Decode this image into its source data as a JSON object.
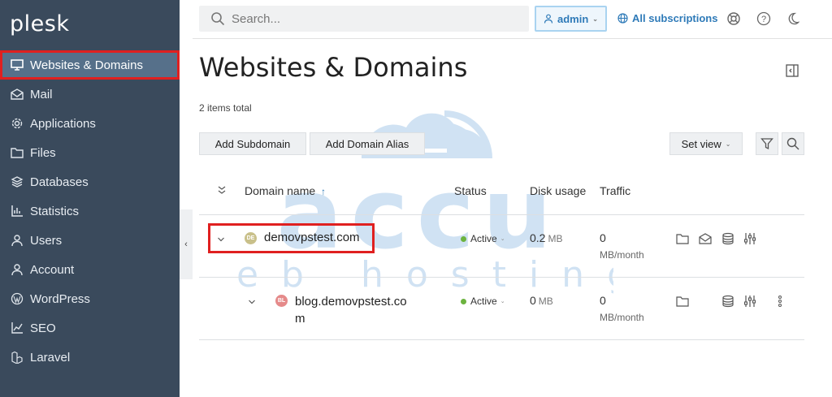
{
  "app": {
    "logo": "plesk"
  },
  "sidebar": {
    "items": [
      {
        "label": "Websites & Domains",
        "icon": "monitor-icon"
      },
      {
        "label": "Mail",
        "icon": "mail-icon"
      },
      {
        "label": "Applications",
        "icon": "gear-icon"
      },
      {
        "label": "Files",
        "icon": "folder-icon"
      },
      {
        "label": "Databases",
        "icon": "database-icon"
      },
      {
        "label": "Statistics",
        "icon": "bar-chart-icon"
      },
      {
        "label": "Users",
        "icon": "user-icon"
      },
      {
        "label": "Account",
        "icon": "account-icon"
      },
      {
        "label": "WordPress",
        "icon": "wordpress-icon"
      },
      {
        "label": "SEO",
        "icon": "seo-icon"
      },
      {
        "label": "Laravel",
        "icon": "laravel-icon"
      }
    ]
  },
  "topbar": {
    "search_placeholder": "Search...",
    "user_label": "admin",
    "subscriptions_label": "All subscriptions"
  },
  "main": {
    "title": "Websites & Domains",
    "items_total": "2 items total",
    "toolbar": {
      "add_subdomain": "Add Subdomain",
      "add_domain_alias": "Add Domain Alias",
      "set_view": "Set view"
    },
    "table": {
      "columns": [
        "Domain name",
        "Status",
        "Disk usage",
        "Traffic"
      ],
      "sort_indicator": "↑",
      "rows": [
        {
          "avatar": "DE",
          "avatar_color": "#c9c08a",
          "domain_name": "demovpstest.com",
          "status": "Active",
          "disk_value": "0.2",
          "disk_unit": "MB",
          "traffic_value": "0",
          "traffic_unit": "MB/month"
        },
        {
          "avatar": "BL",
          "avatar_color": "#e58a8a",
          "domain_name_line1": "blog.demovpstest.co",
          "domain_name_line2": "m",
          "status": "Active",
          "disk_value": "0",
          "disk_unit": "MB",
          "traffic_value": "0",
          "traffic_unit": "MB/month"
        }
      ]
    }
  },
  "watermark": {
    "line1": "accu",
    "line2": "web hosting"
  },
  "colors": {
    "sidebar_bg": "#3a4a5c",
    "accent": "#2e7ab8",
    "highlight": "#e02020",
    "active_status": "#6cb33f"
  }
}
